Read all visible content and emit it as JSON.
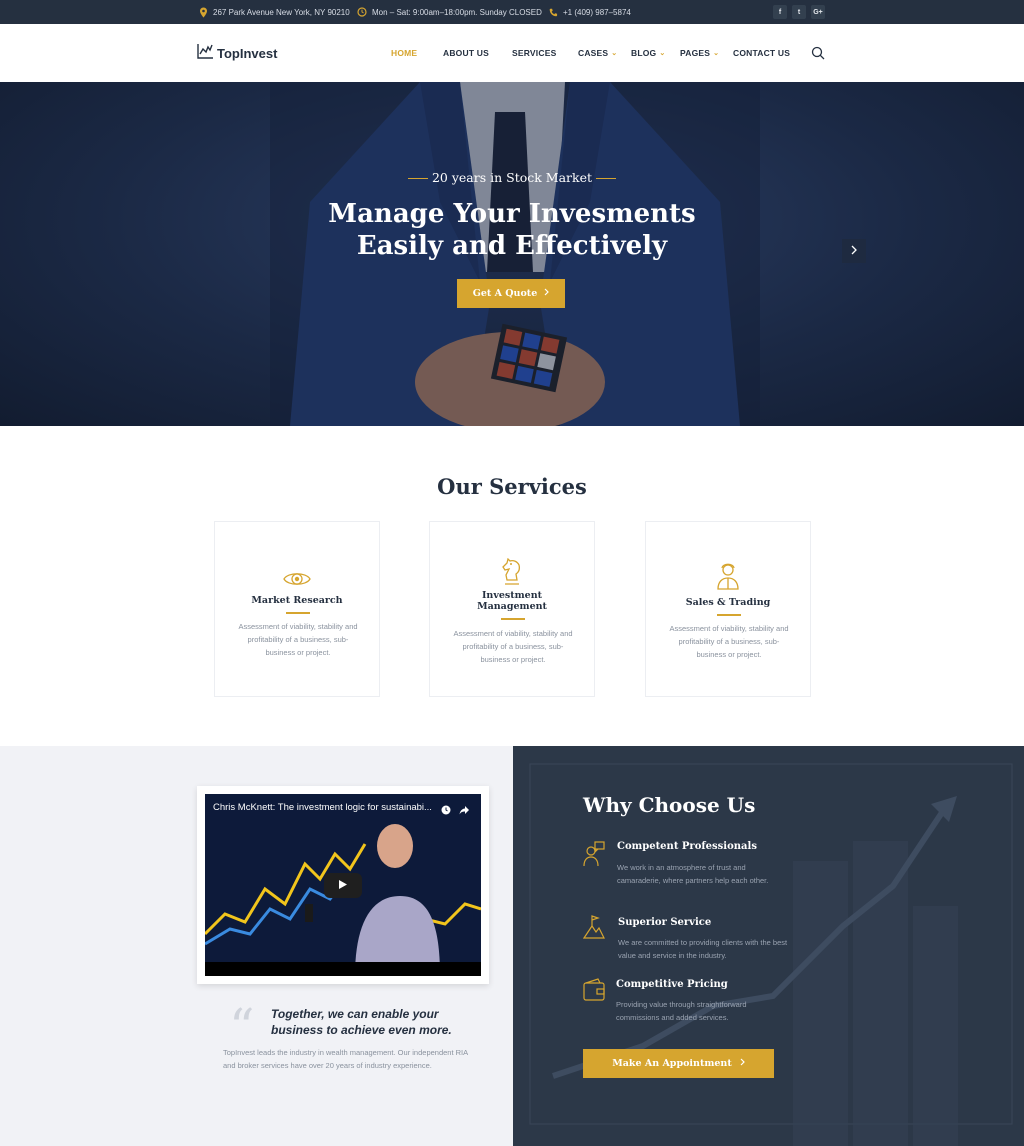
{
  "topbar": {
    "address": "267 Park Avenue New York, NY 90210",
    "hours": "Mon – Sat: 9:00am–18:00pm. Sunday CLOSED",
    "phone": "+1 (409) 987–5874",
    "social": [
      "f",
      "t",
      "G+"
    ]
  },
  "header": {
    "logo": "TopInvest",
    "nav": {
      "home": "HOME",
      "about": "ABOUT US",
      "services": "SERVICES",
      "cases": "CASES",
      "blog": "BLOG",
      "pages": "PAGES",
      "contact": "CONTACT US"
    },
    "chevron": "⌄"
  },
  "hero": {
    "tag": "20 years in Stock Market",
    "title_line1": "Manage Your Invesments",
    "title_line2": "Easily and Effectively",
    "button": "Get A Quote"
  },
  "services": {
    "title": "Our Services",
    "items": [
      {
        "icon": "eye-icon",
        "title_line1": "Market Research",
        "title_line2": "",
        "text": "Assessment of viability, stability and profitability of a business, sub-business or project."
      },
      {
        "icon": "chess-knight-icon",
        "title_line1": "Investment",
        "title_line2": "Management",
        "text": "Assessment of viability, stability and profitability of a business, sub-business or project."
      },
      {
        "icon": "trader-icon",
        "title_line1": "Sales & Trading",
        "title_line2": "",
        "text": "Assessment of viability, stability and profitability of a business, sub-business or project."
      }
    ]
  },
  "video": {
    "title": "Chris McKnett: The investment logic for sustainabi..."
  },
  "quote": {
    "mark": "“",
    "text": "Together, we can enable your business to achieve even more.",
    "about": "TopInvest leads the industry in wealth management. Our independent RIA and broker services have over 20 years of industry experience."
  },
  "why": {
    "title": "Why Choose Us",
    "features": [
      {
        "icon": "professional-icon",
        "title": "Competent Professionals",
        "text": "We work in an atmosphere of trust and camaraderie, where partners help each other."
      },
      {
        "icon": "mountain-flag-icon",
        "title": "Superior Service",
        "text": "We are committed to providing clients with the best value and service in the industry."
      },
      {
        "icon": "wallet-icon",
        "title": "Competitive Pricing",
        "text": "Providing value through straightforward commissions and added services."
      }
    ],
    "button": "Make An Appointment"
  },
  "colors": {
    "accent": "#d6a52f",
    "dark": "#253040",
    "panel": "#2c3848",
    "light_bg": "#f1f2f6"
  }
}
